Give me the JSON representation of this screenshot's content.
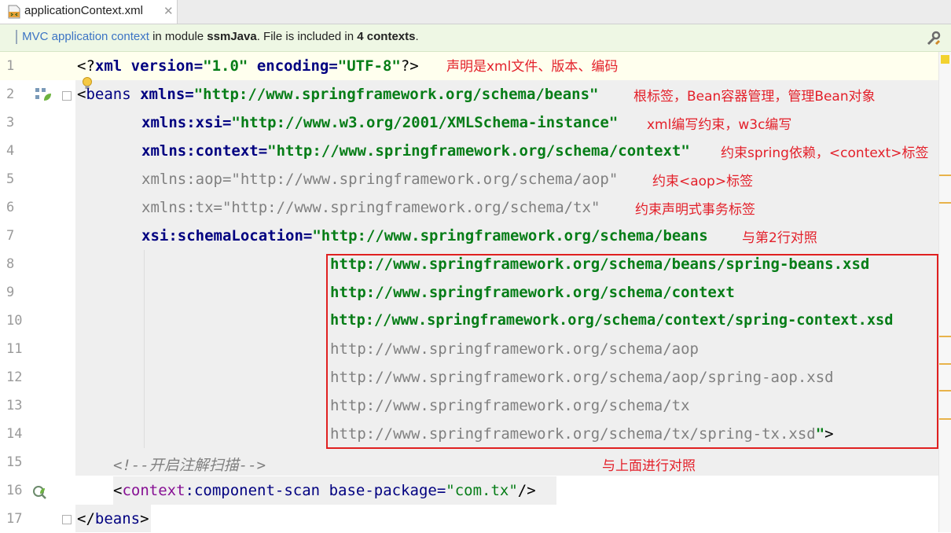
{
  "tab": {
    "label": "applicationContext.xml",
    "close": "✕"
  },
  "banner": {
    "link": "MVC application context",
    "in_module": " in module ",
    "module": "ssmJava",
    "file_included": ". File is included in ",
    "contexts": "4 contexts",
    "end": "."
  },
  "lines": [
    {
      "n": "1"
    },
    {
      "n": "2"
    },
    {
      "n": "3"
    },
    {
      "n": "4"
    },
    {
      "n": "5"
    },
    {
      "n": "6"
    },
    {
      "n": "7"
    },
    {
      "n": "8"
    },
    {
      "n": "9"
    },
    {
      "n": "10"
    },
    {
      "n": "11"
    },
    {
      "n": "12"
    },
    {
      "n": "13"
    },
    {
      "n": "14"
    },
    {
      "n": "15"
    },
    {
      "n": "16"
    },
    {
      "n": "17"
    }
  ],
  "code": {
    "l1": {
      "a": "<?",
      "b": "xml version=",
      "c": "\"1.0\"",
      "d": " encoding=",
      "e": "\"UTF-8\"",
      "f": "?>"
    },
    "l2": {
      "a": "<",
      "b": "beans ",
      "c": "xmlns=",
      "d": "\"http://www.springframework.org/schema/beans\""
    },
    "l3": {
      "a": "xmlns:xsi=",
      "b": "\"http://www.w3.org/2001/XMLSchema-instance\""
    },
    "l4": {
      "a": "xmlns:context=",
      "b": "\"http://www.springframework.org/schema/context\""
    },
    "l5": {
      "a": "xmlns:aop=\"http://www.springframework.org/schema/aop\""
    },
    "l6": {
      "a": "xmlns:tx=\"http://www.springframework.org/schema/tx\""
    },
    "l7": {
      "a": "xsi:schemaLocation=",
      "b": "\"http://www.springframework.org/schema/beans"
    },
    "l8": {
      "a": "http://www.springframework.org/schema/beans/spring-beans.xsd"
    },
    "l9": {
      "a": "http://www.springframework.org/schema/context"
    },
    "l10": {
      "a": "http://www.springframework.org/schema/context/spring-context.xsd"
    },
    "l11": {
      "a": "http://www.springframework.org/schema/aop"
    },
    "l12": {
      "a": "http://www.springframework.org/schema/aop/spring-aop.xsd"
    },
    "l13": {
      "a": "http://www.springframework.org/schema/tx"
    },
    "l14": {
      "a": "http://www.springframework.org/schema/tx/spring-tx.xsd",
      "b": "\"",
      "c": ">"
    },
    "l15": {
      "a": "<!--开启注解扫描-->"
    },
    "l16": {
      "a": "<",
      "b": "context",
      "c": ":component-scan ",
      "d": "base-package=",
      "e": "\"com.tx\"",
      "f": "/>"
    },
    "l17": {
      "a": "</",
      "b": "beans",
      "c": ">"
    }
  },
  "annotations": {
    "a1": "声明是xml文件、版本、编码",
    "a2": "根标签，Bean容器管理，管理Bean对象",
    "a3": "xml编写约束，w3c编写",
    "a4": "约束spring依赖，<context>标签",
    "a5": "约束<aop>标签",
    "a6": "约束声明式事务标签",
    "a7": "与第2行对照",
    "a8": "与上面进行对照"
  },
  "colors": {
    "annotation": "#e3202a",
    "tag": "#000080",
    "value": "#067d17",
    "unused": "#808080",
    "banner_bg": "#eef7e4"
  },
  "icons": [
    "xml-file-icon",
    "close-icon",
    "tools-icon",
    "bulb-icon",
    "spring-bean-icon",
    "spring-scan-icon",
    "fold-icon"
  ]
}
